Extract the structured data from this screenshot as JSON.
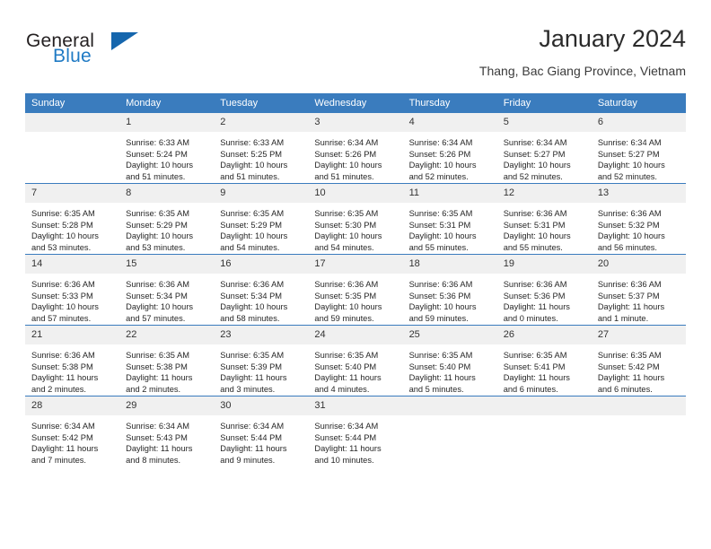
{
  "brand": {
    "name_part1": "General",
    "name_part2": "Blue",
    "logo_icon": "triangle-logo-icon"
  },
  "header": {
    "title": "January 2024",
    "subtitle": "Thang, Bac Giang Province, Vietnam"
  },
  "colors": {
    "header_row_bg": "#3a7cbe",
    "daynum_bg": "#f0f0f0",
    "brand_blue": "#1f7ac4",
    "logo_blue": "#1566ad",
    "text": "#262626"
  },
  "weekdays": [
    "Sunday",
    "Monday",
    "Tuesday",
    "Wednesday",
    "Thursday",
    "Friday",
    "Saturday"
  ],
  "weeks": [
    [
      {
        "day": "",
        "blank": true,
        "sunrise": "",
        "sunset": "",
        "daylight_line1": "",
        "daylight_line2": ""
      },
      {
        "day": "1",
        "sunrise": "Sunrise: 6:33 AM",
        "sunset": "Sunset: 5:24 PM",
        "daylight_line1": "Daylight: 10 hours",
        "daylight_line2": "and 51 minutes."
      },
      {
        "day": "2",
        "sunrise": "Sunrise: 6:33 AM",
        "sunset": "Sunset: 5:25 PM",
        "daylight_line1": "Daylight: 10 hours",
        "daylight_line2": "and 51 minutes."
      },
      {
        "day": "3",
        "sunrise": "Sunrise: 6:34 AM",
        "sunset": "Sunset: 5:26 PM",
        "daylight_line1": "Daylight: 10 hours",
        "daylight_line2": "and 51 minutes."
      },
      {
        "day": "4",
        "sunrise": "Sunrise: 6:34 AM",
        "sunset": "Sunset: 5:26 PM",
        "daylight_line1": "Daylight: 10 hours",
        "daylight_line2": "and 52 minutes."
      },
      {
        "day": "5",
        "sunrise": "Sunrise: 6:34 AM",
        "sunset": "Sunset: 5:27 PM",
        "daylight_line1": "Daylight: 10 hours",
        "daylight_line2": "and 52 minutes."
      },
      {
        "day": "6",
        "sunrise": "Sunrise: 6:34 AM",
        "sunset": "Sunset: 5:27 PM",
        "daylight_line1": "Daylight: 10 hours",
        "daylight_line2": "and 52 minutes."
      }
    ],
    [
      {
        "day": "7",
        "sunrise": "Sunrise: 6:35 AM",
        "sunset": "Sunset: 5:28 PM",
        "daylight_line1": "Daylight: 10 hours",
        "daylight_line2": "and 53 minutes."
      },
      {
        "day": "8",
        "sunrise": "Sunrise: 6:35 AM",
        "sunset": "Sunset: 5:29 PM",
        "daylight_line1": "Daylight: 10 hours",
        "daylight_line2": "and 53 minutes."
      },
      {
        "day": "9",
        "sunrise": "Sunrise: 6:35 AM",
        "sunset": "Sunset: 5:29 PM",
        "daylight_line1": "Daylight: 10 hours",
        "daylight_line2": "and 54 minutes."
      },
      {
        "day": "10",
        "sunrise": "Sunrise: 6:35 AM",
        "sunset": "Sunset: 5:30 PM",
        "daylight_line1": "Daylight: 10 hours",
        "daylight_line2": "and 54 minutes."
      },
      {
        "day": "11",
        "sunrise": "Sunrise: 6:35 AM",
        "sunset": "Sunset: 5:31 PM",
        "daylight_line1": "Daylight: 10 hours",
        "daylight_line2": "and 55 minutes."
      },
      {
        "day": "12",
        "sunrise": "Sunrise: 6:36 AM",
        "sunset": "Sunset: 5:31 PM",
        "daylight_line1": "Daylight: 10 hours",
        "daylight_line2": "and 55 minutes."
      },
      {
        "day": "13",
        "sunrise": "Sunrise: 6:36 AM",
        "sunset": "Sunset: 5:32 PM",
        "daylight_line1": "Daylight: 10 hours",
        "daylight_line2": "and 56 minutes."
      }
    ],
    [
      {
        "day": "14",
        "sunrise": "Sunrise: 6:36 AM",
        "sunset": "Sunset: 5:33 PM",
        "daylight_line1": "Daylight: 10 hours",
        "daylight_line2": "and 57 minutes."
      },
      {
        "day": "15",
        "sunrise": "Sunrise: 6:36 AM",
        "sunset": "Sunset: 5:34 PM",
        "daylight_line1": "Daylight: 10 hours",
        "daylight_line2": "and 57 minutes."
      },
      {
        "day": "16",
        "sunrise": "Sunrise: 6:36 AM",
        "sunset": "Sunset: 5:34 PM",
        "daylight_line1": "Daylight: 10 hours",
        "daylight_line2": "and 58 minutes."
      },
      {
        "day": "17",
        "sunrise": "Sunrise: 6:36 AM",
        "sunset": "Sunset: 5:35 PM",
        "daylight_line1": "Daylight: 10 hours",
        "daylight_line2": "and 59 minutes."
      },
      {
        "day": "18",
        "sunrise": "Sunrise: 6:36 AM",
        "sunset": "Sunset: 5:36 PM",
        "daylight_line1": "Daylight: 10 hours",
        "daylight_line2": "and 59 minutes."
      },
      {
        "day": "19",
        "sunrise": "Sunrise: 6:36 AM",
        "sunset": "Sunset: 5:36 PM",
        "daylight_line1": "Daylight: 11 hours",
        "daylight_line2": "and 0 minutes."
      },
      {
        "day": "20",
        "sunrise": "Sunrise: 6:36 AM",
        "sunset": "Sunset: 5:37 PM",
        "daylight_line1": "Daylight: 11 hours",
        "daylight_line2": "and 1 minute."
      }
    ],
    [
      {
        "day": "21",
        "sunrise": "Sunrise: 6:36 AM",
        "sunset": "Sunset: 5:38 PM",
        "daylight_line1": "Daylight: 11 hours",
        "daylight_line2": "and 2 minutes."
      },
      {
        "day": "22",
        "sunrise": "Sunrise: 6:35 AM",
        "sunset": "Sunset: 5:38 PM",
        "daylight_line1": "Daylight: 11 hours",
        "daylight_line2": "and 2 minutes."
      },
      {
        "day": "23",
        "sunrise": "Sunrise: 6:35 AM",
        "sunset": "Sunset: 5:39 PM",
        "daylight_line1": "Daylight: 11 hours",
        "daylight_line2": "and 3 minutes."
      },
      {
        "day": "24",
        "sunrise": "Sunrise: 6:35 AM",
        "sunset": "Sunset: 5:40 PM",
        "daylight_line1": "Daylight: 11 hours",
        "daylight_line2": "and 4 minutes."
      },
      {
        "day": "25",
        "sunrise": "Sunrise: 6:35 AM",
        "sunset": "Sunset: 5:40 PM",
        "daylight_line1": "Daylight: 11 hours",
        "daylight_line2": "and 5 minutes."
      },
      {
        "day": "26",
        "sunrise": "Sunrise: 6:35 AM",
        "sunset": "Sunset: 5:41 PM",
        "daylight_line1": "Daylight: 11 hours",
        "daylight_line2": "and 6 minutes."
      },
      {
        "day": "27",
        "sunrise": "Sunrise: 6:35 AM",
        "sunset": "Sunset: 5:42 PM",
        "daylight_line1": "Daylight: 11 hours",
        "daylight_line2": "and 6 minutes."
      }
    ],
    [
      {
        "day": "28",
        "sunrise": "Sunrise: 6:34 AM",
        "sunset": "Sunset: 5:42 PM",
        "daylight_line1": "Daylight: 11 hours",
        "daylight_line2": "and 7 minutes."
      },
      {
        "day": "29",
        "sunrise": "Sunrise: 6:34 AM",
        "sunset": "Sunset: 5:43 PM",
        "daylight_line1": "Daylight: 11 hours",
        "daylight_line2": "and 8 minutes."
      },
      {
        "day": "30",
        "sunrise": "Sunrise: 6:34 AM",
        "sunset": "Sunset: 5:44 PM",
        "daylight_line1": "Daylight: 11 hours",
        "daylight_line2": "and 9 minutes."
      },
      {
        "day": "31",
        "sunrise": "Sunrise: 6:34 AM",
        "sunset": "Sunset: 5:44 PM",
        "daylight_line1": "Daylight: 11 hours",
        "daylight_line2": "and 10 minutes."
      },
      {
        "day": "",
        "blank": true,
        "sunrise": "",
        "sunset": "",
        "daylight_line1": "",
        "daylight_line2": ""
      },
      {
        "day": "",
        "blank": true,
        "sunrise": "",
        "sunset": "",
        "daylight_line1": "",
        "daylight_line2": ""
      },
      {
        "day": "",
        "blank": true,
        "sunrise": "",
        "sunset": "",
        "daylight_line1": "",
        "daylight_line2": ""
      }
    ]
  ]
}
